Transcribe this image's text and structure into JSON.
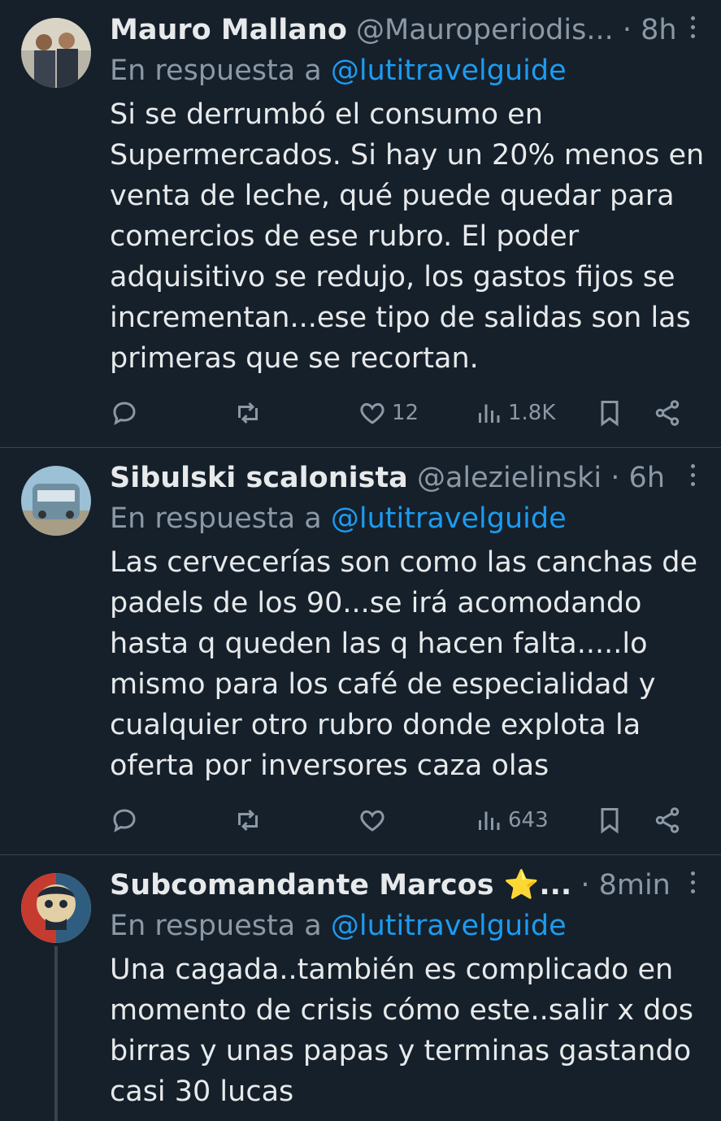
{
  "tweets": [
    {
      "name": "Mauro Mallano",
      "handle": "@Mauroperiodis...",
      "time": "· 8h",
      "reply_prefix": "En respuesta a",
      "reply_to": "@lutitravelguide",
      "text": "Si se derrumbó el consumo en Supermercados. Si hay un  20% menos en venta de leche, qué puede quedar para comercios de ese rubro. El poder adquisitivo se redujo, los gastos fijos se incrementan...ese tipo de salidas son las primeras que se recortan.",
      "likes": "12",
      "views": "1.8K"
    },
    {
      "name": "Sibulski scalonista",
      "handle": "@alezielinski",
      "time": "· 6h",
      "reply_prefix": "En respuesta a",
      "reply_to": "@lutitravelguide",
      "text": "Las cervecerías son como las canchas de padels de los 90...se irá acomodando hasta q queden las q hacen falta.....lo mismo para los café de especialidad y cualquier otro rubro donde explota la oferta por inversores caza olas",
      "likes": "",
      "views": "643"
    },
    {
      "name": "Subcomandante Marcos ⭐...",
      "handle": "",
      "time": "· 8min",
      "reply_prefix": "En respuesta a",
      "reply_to": "@lutitravelguide",
      "text": "Una cagada..también es complicado en momento de crisis cómo este..salir x dos birras y unas papas y terminas gastando casi 30 lucas",
      "likes": "",
      "views": ""
    }
  ],
  "icons": {
    "reply": "reply-icon",
    "retweet": "retweet-icon",
    "like": "heart-icon",
    "views": "views-icon",
    "bookmark": "bookmark-icon",
    "share": "share-icon"
  },
  "colors": {
    "background": "#15202b",
    "text": "#e7e9ea",
    "muted": "#8b98a5",
    "link": "#1d9bf0",
    "divider": "#38444d"
  }
}
